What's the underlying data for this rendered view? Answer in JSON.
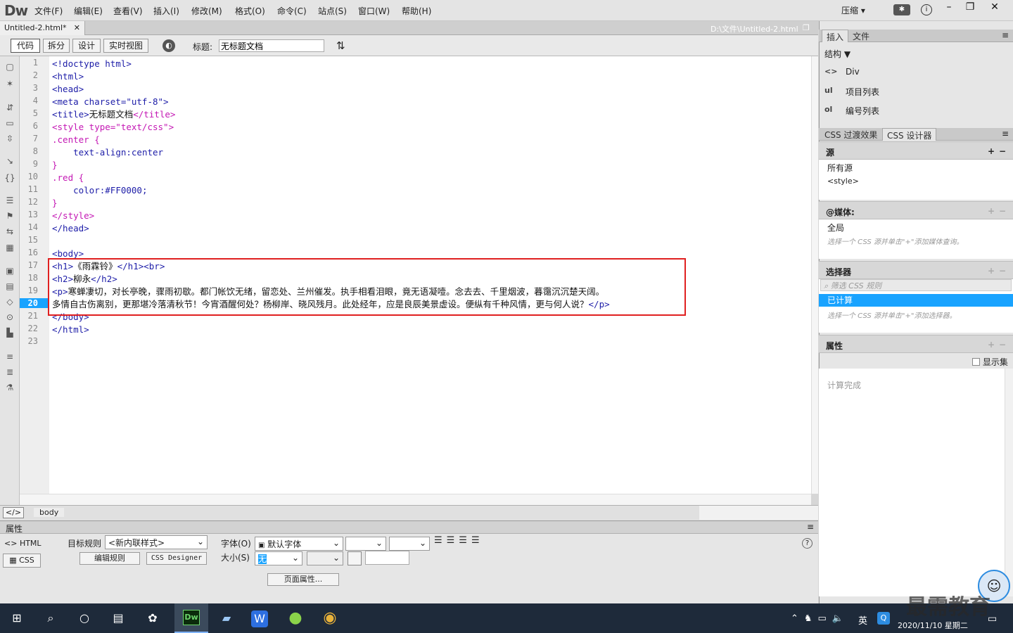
{
  "app": {
    "logo": "Dw",
    "layout_selector": "压缩 ▾"
  },
  "menu": [
    "文件(F)",
    "编辑(E)",
    "查看(V)",
    "插入(I)",
    "修改(M)",
    "格式(O)",
    "命令(C)",
    "站点(S)",
    "窗口(W)",
    "帮助(H)"
  ],
  "document": {
    "tab_label": "Untitled-2.html*",
    "path": "D:\\文件\\Untitled-2.html"
  },
  "toolbar": {
    "views": [
      "代码",
      "拆分",
      "设计",
      "实时视图"
    ],
    "title_label": "标题:",
    "title_value": "无标题文档"
  },
  "code_lines": [
    {
      "n": "1",
      "html": "<span class='tag'>&lt;!doctype html&gt;</span>"
    },
    {
      "n": "2",
      "html": "<span class='tag'>&lt;html&gt;</span>"
    },
    {
      "n": "3",
      "html": "<span class='tag'>&lt;head&gt;</span>"
    },
    {
      "n": "4",
      "html": "<span class='tag'>&lt;meta charset=\"utf-8\"&gt;</span>"
    },
    {
      "n": "5",
      "html": "<span class='tag'>&lt;title&gt;</span><span class='txt'>无标题文档</span><span class='css'>&lt;/title&gt;</span>"
    },
    {
      "n": "6",
      "html": "<span class='css'>&lt;style type=\"text/css\"&gt;</span>"
    },
    {
      "n": "7",
      "html": "<span class='css'>.center {</span>"
    },
    {
      "n": "8",
      "html": "    <span class='prop'>text-align:center</span>"
    },
    {
      "n": "9",
      "html": "<span class='css'>}</span>"
    },
    {
      "n": "10",
      "html": "<span class='css'>.red {</span>"
    },
    {
      "n": "11",
      "html": "    <span class='prop'>color:#FF0000;</span>"
    },
    {
      "n": "12",
      "html": "<span class='css'>}</span>"
    },
    {
      "n": "13",
      "html": "<span class='css'>&lt;/style&gt;</span>"
    },
    {
      "n": "14",
      "html": "<span class='tag'>&lt;/head&gt;</span>"
    },
    {
      "n": "15",
      "html": ""
    },
    {
      "n": "16",
      "html": "<span class='tag'>&lt;body&gt;</span>"
    },
    {
      "n": "17",
      "html": "<span class='tag'>&lt;h1&gt;</span><span class='txt'>《雨霖铃》</span><span class='tag'>&lt;/h1&gt;&lt;br&gt;</span>"
    },
    {
      "n": "18",
      "html": "<span class='tag'>&lt;h2&gt;</span><span class='txt'>柳永</span><span class='tag'>&lt;/h2&gt;</span>"
    },
    {
      "n": "19",
      "html": "<span class='tag'>&lt;p&gt;</span><span class='txt'>寒蝉凄切，对长亭晚，骤雨初歇。都门帐饮无绪，留恋处、兰州催发。执手相看泪眼，竟无语凝噎。念去去、千里烟波，暮霭沉沉楚天阔。</span>"
    },
    {
      "n": "20",
      "html": "<span class='txt'>多情自古伤离别，更那堪冷落清秋节！今宵酒醒何处？杨柳岸、晓风残月。此处经年，应是良辰美景虚设。便纵有千种风情，更与何人说？</span><span class='tag'>&lt;/p&gt;</span>"
    },
    {
      "n": "21",
      "html": "<span class='tag'>&lt;/body&gt;</span>"
    },
    {
      "n": "22",
      "html": "<span class='tag'>&lt;/html&gt;</span>"
    },
    {
      "n": "23",
      "html": ""
    }
  ],
  "tag_selector": {
    "icon": "</>",
    "tag": "body"
  },
  "properties": {
    "header": "属性",
    "html_btn": "HTML",
    "css_btn": "CSS",
    "target_rule_label": "目标规则",
    "target_rule_value": "<新内联样式>",
    "edit_rule": "编辑规则",
    "css_designer": "CSS Designer",
    "font_label": "字体(O)",
    "font_value": "默认字体",
    "size_label": "大小(S)",
    "size_value": "无",
    "page_props": "页面属性..."
  },
  "insert_panel": {
    "tabs": [
      "插入",
      "文件"
    ],
    "category": "结构",
    "items": [
      {
        "icon": "<>",
        "label": "Div"
      },
      {
        "icon": "ul",
        "label": "项目列表"
      },
      {
        "icon": "ol",
        "label": "编号列表"
      }
    ]
  },
  "css_panel": {
    "tabs": [
      "CSS 过渡效果",
      "CSS 设计器"
    ],
    "sources_title": "源",
    "sources": [
      "所有源",
      "<style>"
    ],
    "media_title": "@媒体:",
    "media_value": "全局",
    "media_hint": "选择一个 CSS 源并单击\"+\"添加媒体查询。",
    "selectors_title": "选择器",
    "selector_filter_placeholder": "筛选 CSS 规则",
    "selector_selected": "已计算",
    "selector_hint": "选择一个 CSS 源并单击\"+\"添加选择器。",
    "props_title": "属性",
    "show_set": "显示集",
    "computed_done": "计算完成"
  },
  "taskbar": {
    "ime": "英",
    "clock_date": "2020/11/10 星期二",
    "watermark": "最需教育"
  },
  "colors": {
    "highlight_box": "#e02020",
    "selected_row": "#19a3ff",
    "taskbar": "#1e2a3a"
  }
}
